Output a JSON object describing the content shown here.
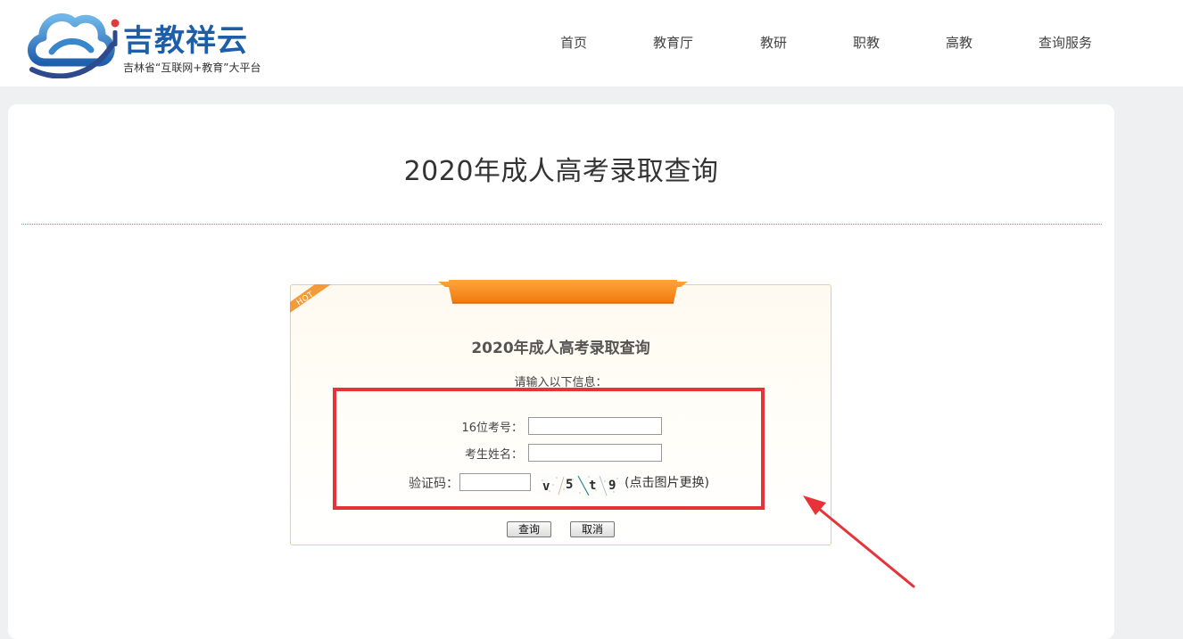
{
  "header": {
    "brand_name": "吉教祥云",
    "brand_slogan": "吉林省“互联网+教育”大平台",
    "nav": [
      "首页",
      "教育厅",
      "教研",
      "职教",
      "高教",
      "查询服务"
    ]
  },
  "page": {
    "title": "2020年成人高考录取查询"
  },
  "query_form": {
    "hot_badge": "HOT",
    "title": "2020年成人高考录取查询",
    "hint": "请输入以下信息：",
    "exam_number_label": "16位考号：",
    "exam_number_value": "",
    "name_label": "考生姓名：",
    "name_value": "",
    "captcha_label": "验证码：",
    "captcha_value": "",
    "captcha_chars": [
      "v",
      "5",
      "t",
      "9"
    ],
    "captcha_note": "(点击图片更换)",
    "submit_label": "查询",
    "cancel_label": "取消"
  },
  "colors": {
    "brand_blue": "#1d5ea8",
    "ribbon_orange": "#f68a1e",
    "annotation_red": "#e8323a",
    "box_border": "#f0cf7d"
  },
  "icons": [
    "cloud-logo-icon",
    "hot-corner-badge",
    "annotation-arrow"
  ]
}
